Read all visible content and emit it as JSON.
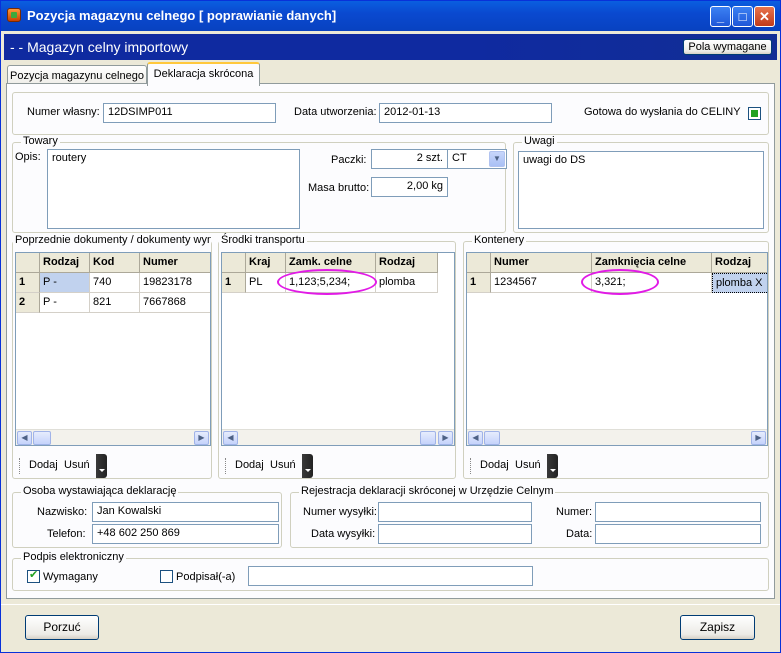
{
  "window": {
    "title": "Pozycja magazynu celnego [ poprawianie danych]"
  },
  "banner": {
    "title": "- - Magazyn celny importowy",
    "required_button": "Pola wymagane"
  },
  "tabs": [
    {
      "label": "Pozycja magazynu celnego"
    },
    {
      "label": "Deklaracja skrócona"
    }
  ],
  "header": {
    "own_number_label": "Numer własny:",
    "own_number": "12DSIMP011",
    "created_label": "Data utworzenia:",
    "created": "2012-01-13",
    "ready_label": "Gotowa do wysłania do CELINY"
  },
  "goods": {
    "title": "Towary",
    "desc_label": "Opis:",
    "desc": "routery",
    "packages_label": "Paczki:",
    "packages": "2 szt.",
    "package_type": "CT",
    "mass_label": "Masa brutto:",
    "mass": "2,00 kg"
  },
  "notes": {
    "title": "Uwagi",
    "text": "uwagi do DS"
  },
  "prev_docs": {
    "title": "Poprzednie dokumenty / dokumenty wyn",
    "columns": [
      "Rodzaj",
      "Kod",
      "Numer"
    ],
    "rows": [
      {
        "n": "1",
        "rodzaj": "P -",
        "kod": "740",
        "numer": "19823178"
      },
      {
        "n": "2",
        "rodzaj": "P -",
        "kod": "821",
        "numer": "7667868"
      }
    ]
  },
  "transport": {
    "title": "Środki transportu",
    "columns": [
      "Kraj",
      "Zamk. celne",
      "Rodzaj"
    ],
    "rows": [
      {
        "n": "1",
        "kraj": "PL",
        "zamk": "1,123;5,234;",
        "rodzaj": "plomba"
      }
    ]
  },
  "containers": {
    "title": "Kontenery",
    "columns": [
      "Numer",
      "Zamknięcia celne",
      "Rodzaj"
    ],
    "rows": [
      {
        "n": "1",
        "numer": "1234567",
        "zamk": "3,321;",
        "rodzaj": "plomba X"
      }
    ]
  },
  "toolbar": {
    "add": "Dodaj",
    "remove": "Usuń"
  },
  "person": {
    "title": "Osoba wystawiająca deklarację",
    "name_label": "Nazwisko:",
    "name": "Jan Kowalski",
    "phone_label": "Telefon:",
    "phone": "+48 602 250 869"
  },
  "registration": {
    "title": "Rejestracja deklaracji skróconej w Urzędzie Celnym",
    "sent_no_label": "Numer wysyłki:",
    "sent_date_label": "Data wysyłki:",
    "number_label": "Numer:",
    "date_label": "Data:"
  },
  "signature": {
    "title": "Podpis elektroniczny",
    "required_label": "Wymagany",
    "signed_label": "Podpisał(-a)"
  },
  "footer": {
    "abandon": "Porzuć",
    "save": "Zapisz"
  }
}
